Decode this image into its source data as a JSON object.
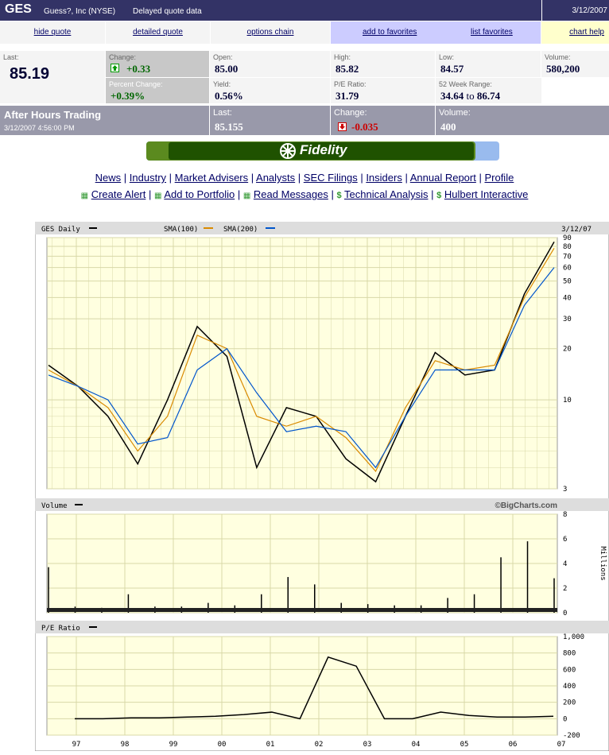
{
  "header": {
    "symbol": "GES",
    "company": "Guess?, Inc (NYSE)",
    "delay_note": "Delayed quote data",
    "date": "3/12/2007"
  },
  "nav": {
    "hide_quote": "hide quote",
    "detailed_quote": "detailed quote",
    "options_chain": "options chain",
    "add_favorites": "add to favorites",
    "list_favorites": "list favorites",
    "chart_help": "chart help"
  },
  "quote": {
    "last_label": "Last:",
    "last": "85.19",
    "change_label": "Change:",
    "change": "+0.33",
    "pct_label": "Percent Change:",
    "pct": "+0.39%",
    "open_label": "Open:",
    "open": "85.00",
    "yield_label": "Yield:",
    "yield": "0.56%",
    "high_label": "High:",
    "high": "85.82",
    "pe_label": "P/E Ratio:",
    "pe": "31.79",
    "low_label": "Low:",
    "low": "84.57",
    "range_label": "52 Week Range:",
    "range_low": "34.64",
    "range_to": "to",
    "range_high": "86.74",
    "volume_label": "Volume:",
    "volume": "580,200"
  },
  "after_hours": {
    "title": "After Hours Trading",
    "time": "3/12/2007 4:56:00 PM",
    "last_label": "Last:",
    "last": "85.155",
    "change_label": "Change:",
    "change": "-0.035",
    "volume_label": "Volume:",
    "volume": "400"
  },
  "brand": "Fidelity",
  "links_row1": [
    "News",
    "Industry",
    "Market Advisers",
    "Analysts",
    "SEC Filings",
    "Insiders",
    "Annual Report",
    "Profile"
  ],
  "links_row2": [
    "Create Alert",
    "Add to Portfolio",
    "Read Messages",
    "Technical Analysis",
    "Hulbert Interactive"
  ],
  "chart_data": [
    {
      "type": "line",
      "panel": "price",
      "title": "GES Daily",
      "legend": [
        "SMA(100)",
        "SMA(200)"
      ],
      "date_label": "3/12/07",
      "yscale": "log",
      "ylim": [
        3,
        90
      ],
      "yticks": [
        "90",
        "80",
        "70",
        "60",
        "50",
        "40",
        "30",
        "20",
        "10",
        "3"
      ],
      "x": [
        "97",
        "98",
        "99",
        "00",
        "01",
        "02",
        "03",
        "04",
        "05",
        "06",
        "07"
      ],
      "series": [
        {
          "name": "GES Daily",
          "values": [
            16,
            12,
            8,
            4.2,
            10,
            27,
            18,
            4,
            9,
            8,
            4.5,
            3.3,
            8,
            19,
            14,
            15,
            42,
            85
          ]
        },
        {
          "name": "SMA(100)",
          "values": [
            15,
            12,
            9,
            5,
            8,
            24,
            20,
            8,
            7,
            8,
            6,
            3.8,
            9,
            17,
            15,
            16,
            40,
            78
          ]
        },
        {
          "name": "SMA(200)",
          "values": [
            14,
            12,
            10,
            5.5,
            6,
            15,
            20,
            11,
            6.5,
            7,
            6.5,
            4,
            8,
            15,
            15,
            15,
            36,
            60
          ]
        }
      ],
      "colors": {
        "price": "#000000",
        "sma100": "#d98a00",
        "sma200": "#0055cc"
      }
    },
    {
      "type": "bar",
      "panel": "volume",
      "title": "Volume",
      "watermark": "©BigCharts.com",
      "ylabel": "Millions",
      "ylim": [
        0,
        8
      ],
      "yticks": [
        "8",
        "6",
        "4",
        "2",
        "0"
      ],
      "values": [
        3.7,
        0.5,
        0.4,
        1.5,
        0.5,
        0.5,
        0.8,
        0.6,
        1.5,
        2.9,
        2.3,
        0.8,
        0.7,
        0.6,
        0.6,
        1.2,
        1.5,
        4.5,
        5.8,
        2.8
      ]
    },
    {
      "type": "line",
      "panel": "pe",
      "title": "P/E Ratio",
      "ylim": [
        -200,
        1000
      ],
      "yticks": [
        "1,000",
        "800",
        "600",
        "400",
        "200",
        "0",
        "-200"
      ],
      "series": [
        {
          "name": "P/E Ratio",
          "values": [
            0,
            0,
            10,
            10,
            20,
            30,
            50,
            80,
            0,
            750,
            640,
            0,
            0,
            80,
            40,
            20,
            20,
            30
          ]
        }
      ]
    }
  ]
}
